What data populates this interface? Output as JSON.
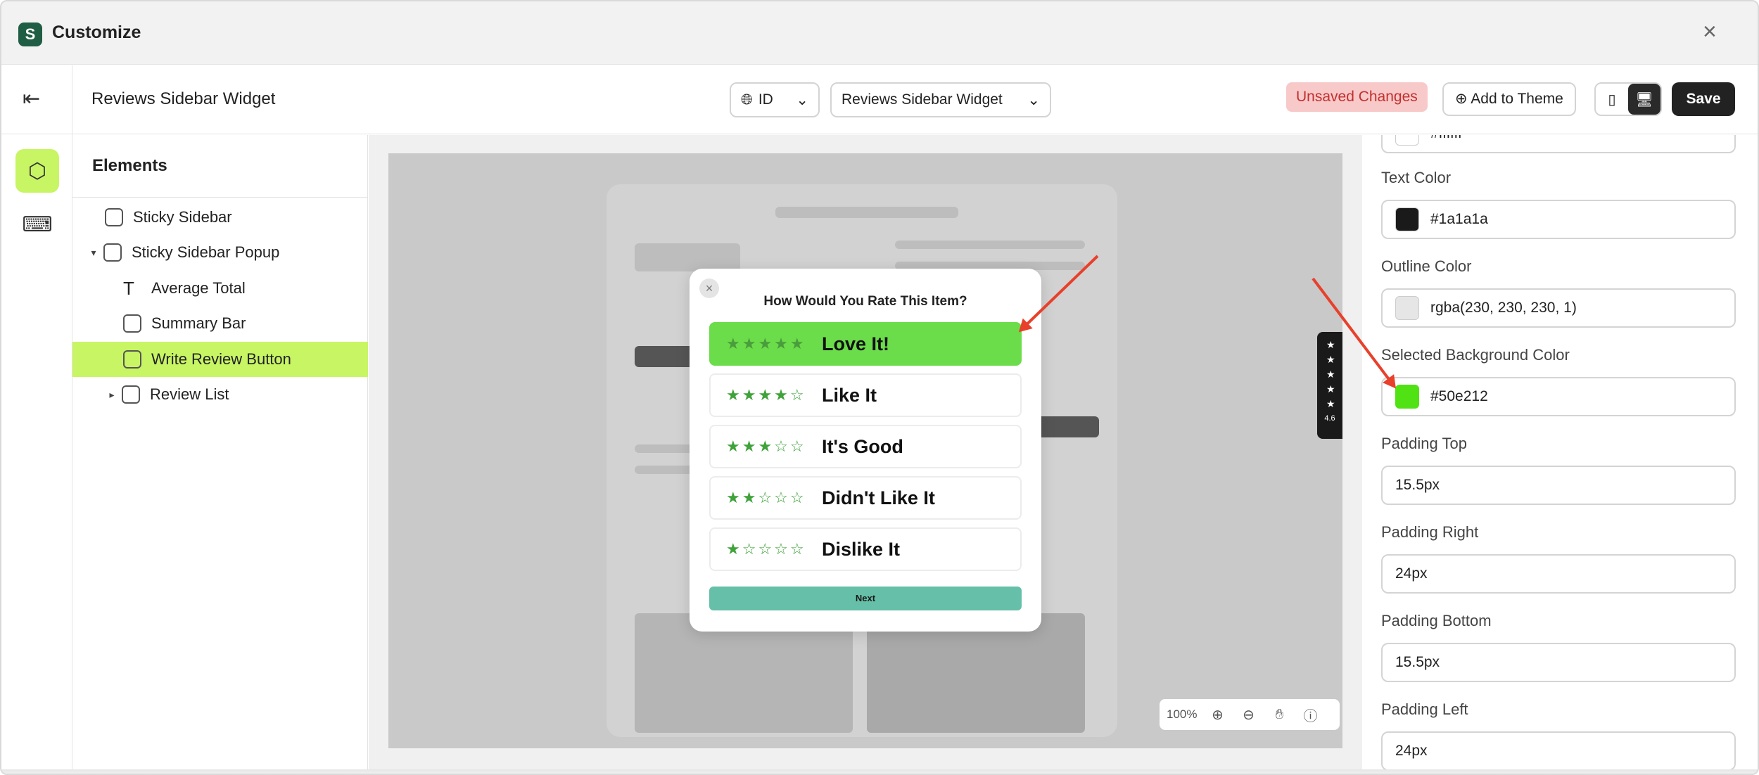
{
  "window": {
    "title": "Customize",
    "close_icon": "×"
  },
  "toolbar": {
    "page_name": "Reviews Sidebar Widget",
    "language": "ID",
    "template_select": "Reviews Sidebar Widget",
    "unsaved_badge": "Unsaved Changes",
    "add_to_theme": "Add to Theme",
    "save": "Save"
  },
  "elements_panel": {
    "heading": "Elements",
    "items": [
      {
        "label": "Sticky Sidebar"
      },
      {
        "label": "Sticky Sidebar Popup"
      },
      {
        "label": "Average Total"
      },
      {
        "label": "Summary Bar"
      },
      {
        "label": "Write Review Button"
      },
      {
        "label": "Review List"
      }
    ],
    "selected": "Write Review Button"
  },
  "preview": {
    "modal": {
      "title": "How Would You Rate This Item?",
      "options": [
        {
          "stars": "★★★★★",
          "label": "Love It!"
        },
        {
          "stars": "★★★★☆",
          "label": "Like It"
        },
        {
          "stars": "★★★☆☆",
          "label": "It's Good"
        },
        {
          "stars": "★★☆☆☆",
          "label": "Didn't Like It"
        },
        {
          "stars": "★☆☆☆☆",
          "label": "Dislike It"
        }
      ],
      "next_button": "Next"
    },
    "side_tab": {
      "stars": "★ ★ ★ ★ ★",
      "rating": "4.6"
    },
    "zoom": "100%"
  },
  "properties": {
    "top_partial_value": "#ffffff",
    "text_color": {
      "label": "Text Color",
      "value": "#1a1a1a",
      "swatch": "#1a1a1a"
    },
    "outline_color": {
      "label": "Outline Color",
      "value": "rgba(230, 230, 230, 1)",
      "swatch": "#e6e6e6"
    },
    "selected_bg": {
      "label": "Selected Background Color",
      "value": "#50e212",
      "swatch": "#50e212"
    },
    "padding_top": {
      "label": "Padding Top",
      "value": "15.5px"
    },
    "padding_right": {
      "label": "Padding Right",
      "value": "24px"
    },
    "padding_bottom": {
      "label": "Padding Bottom",
      "value": "15.5px"
    },
    "padding_left": {
      "label": "Padding Left",
      "value": "24px"
    }
  },
  "colors": {
    "accent": "#c8f564",
    "annotation_arrow": "#e8402b",
    "selected_option": "#6bdc4a"
  }
}
